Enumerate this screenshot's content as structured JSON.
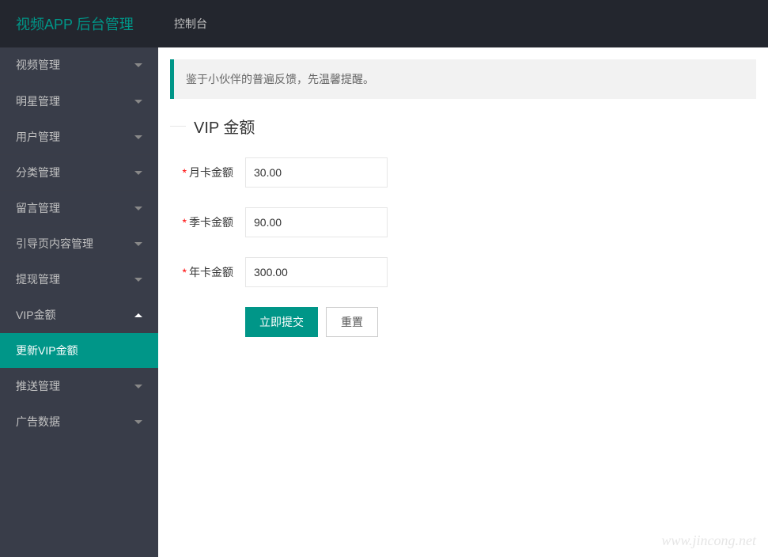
{
  "header": {
    "logo": "视频APP 后台管理",
    "nav_console": "控制台"
  },
  "sidebar": {
    "items": [
      {
        "label": "视频管理",
        "expanded": false
      },
      {
        "label": "明星管理",
        "expanded": false
      },
      {
        "label": "用户管理",
        "expanded": false
      },
      {
        "label": "分类管理",
        "expanded": false
      },
      {
        "label": "留言管理",
        "expanded": false
      },
      {
        "label": "引导页内容管理",
        "expanded": false
      },
      {
        "label": "提现管理",
        "expanded": false
      },
      {
        "label": "VIP金额",
        "expanded": true
      },
      {
        "label": "推送管理",
        "expanded": false
      },
      {
        "label": "广告数据",
        "expanded": false
      }
    ],
    "sub_item": "更新VIP金额"
  },
  "notice": "鉴于小伙伴的普遍反馈，先温馨提醒。",
  "form": {
    "legend": "VIP 金额",
    "fields": {
      "monthly": {
        "label": "月卡金额",
        "value": "30.00"
      },
      "quarterly": {
        "label": "季卡金额",
        "value": "90.00"
      },
      "yearly": {
        "label": "年卡金额",
        "value": "300.00"
      }
    },
    "submit_label": "立即提交",
    "reset_label": "重置"
  },
  "watermark": "www.jincong.net"
}
